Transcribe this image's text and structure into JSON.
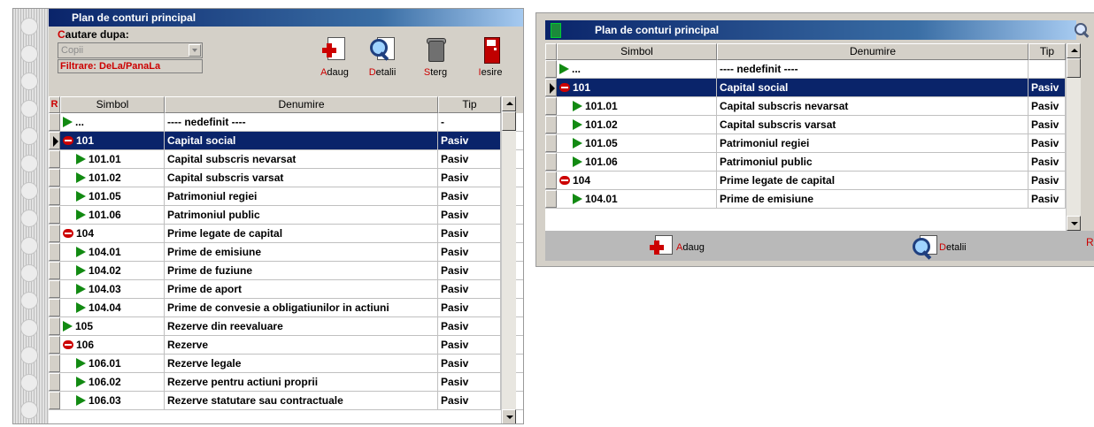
{
  "left": {
    "title": "Plan de conturi principal",
    "search_label": "Cautare dupa:",
    "search_value": "Copii",
    "filter_label": "Filtrare: DeLa/PanaLa",
    "buttons": {
      "add": "Adaug",
      "details": "Detalii",
      "delete": "Sterg",
      "exit": "Iesire"
    },
    "columns": {
      "rowhead": "R",
      "symbol": "Simbol",
      "name": "Denumire",
      "type": "Tip"
    },
    "rows": [
      {
        "symbol": "...",
        "name": "---- nedefinit ----",
        "type": "-",
        "icon": "triangle",
        "level": 0
      },
      {
        "symbol": "101",
        "name": "Capital social",
        "type": "Pasiv",
        "icon": "minus",
        "level": 0,
        "selected": true
      },
      {
        "symbol": "101.01",
        "name": "Capital subscris nevarsat",
        "type": "Pasiv",
        "icon": "triangle",
        "level": 1
      },
      {
        "symbol": "101.02",
        "name": "Capital subscris varsat",
        "type": "Pasiv",
        "icon": "triangle",
        "level": 1
      },
      {
        "symbol": "101.05",
        "name": "Patrimoniul regiei",
        "type": "Pasiv",
        "icon": "triangle",
        "level": 1
      },
      {
        "symbol": "101.06",
        "name": "Patrimoniul public",
        "type": "Pasiv",
        "icon": "triangle",
        "level": 1
      },
      {
        "symbol": "104",
        "name": "Prime legate de capital",
        "type": "Pasiv",
        "icon": "minus",
        "level": 0
      },
      {
        "symbol": "104.01",
        "name": "Prime de emisiune",
        "type": "Pasiv",
        "icon": "triangle",
        "level": 1
      },
      {
        "symbol": "104.02",
        "name": "Prime de fuziune",
        "type": "Pasiv",
        "icon": "triangle",
        "level": 1
      },
      {
        "symbol": "104.03",
        "name": "Prime de aport",
        "type": "Pasiv",
        "icon": "triangle",
        "level": 1
      },
      {
        "symbol": "104.04",
        "name": "Prime de convesie a obligatiunilor in actiuni",
        "type": "Pasiv",
        "icon": "triangle",
        "level": 1
      },
      {
        "symbol": "105",
        "name": "Rezerve din reevaluare",
        "type": "Pasiv",
        "icon": "triangle",
        "level": 0
      },
      {
        "symbol": "106",
        "name": "Rezerve",
        "type": "Pasiv",
        "icon": "minus",
        "level": 0
      },
      {
        "symbol": "106.01",
        "name": "Rezerve legale",
        "type": "Pasiv",
        "icon": "triangle",
        "level": 1
      },
      {
        "symbol": "106.02",
        "name": "Rezerve pentru actiuni proprii",
        "type": "Pasiv",
        "icon": "triangle",
        "level": 1
      },
      {
        "symbol": "106.03",
        "name": "Rezerve statutare sau contractuale",
        "type": "Pasiv",
        "icon": "triangle",
        "level": 1
      }
    ]
  },
  "right": {
    "title": "Plan de conturi principal",
    "columns": {
      "symbol": "Simbol",
      "name": "Denumire",
      "type": "Tip"
    },
    "rows": [
      {
        "symbol": "...",
        "name": "---- nedefinit ----",
        "type": "",
        "icon": "triangle",
        "level": 0
      },
      {
        "symbol": "101",
        "name": "Capital social",
        "type": "Pasiv",
        "icon": "minus",
        "level": 0,
        "selected": true
      },
      {
        "symbol": "101.01",
        "name": "Capital subscris nevarsat",
        "type": "Pasiv",
        "icon": "triangle",
        "level": 1
      },
      {
        "symbol": "101.02",
        "name": "Capital subscris varsat",
        "type": "Pasiv",
        "icon": "triangle",
        "level": 1
      },
      {
        "symbol": "101.05",
        "name": "Patrimoniul regiei",
        "type": "Pasiv",
        "icon": "triangle",
        "level": 1
      },
      {
        "symbol": "101.06",
        "name": "Patrimoniul public",
        "type": "Pasiv",
        "icon": "triangle",
        "level": 1
      },
      {
        "symbol": "104",
        "name": "Prime legate de capital",
        "type": "Pasiv",
        "icon": "minus",
        "level": 0
      },
      {
        "symbol": "104.01",
        "name": "Prime de emisiune",
        "type": "Pasiv",
        "icon": "triangle",
        "level": 1
      }
    ],
    "footer": {
      "add": "Adaug",
      "details": "Detalii",
      "trailing": "R"
    }
  },
  "colors": {
    "selection": "#0a246a",
    "accent_red": "#cc0000",
    "arrow_green": "#128a12"
  },
  "icons": [
    "search-icon",
    "add-document-icon",
    "details-icon",
    "trash-icon",
    "exit-door-icon",
    "green-triangle-icon",
    "red-minus-icon"
  ]
}
